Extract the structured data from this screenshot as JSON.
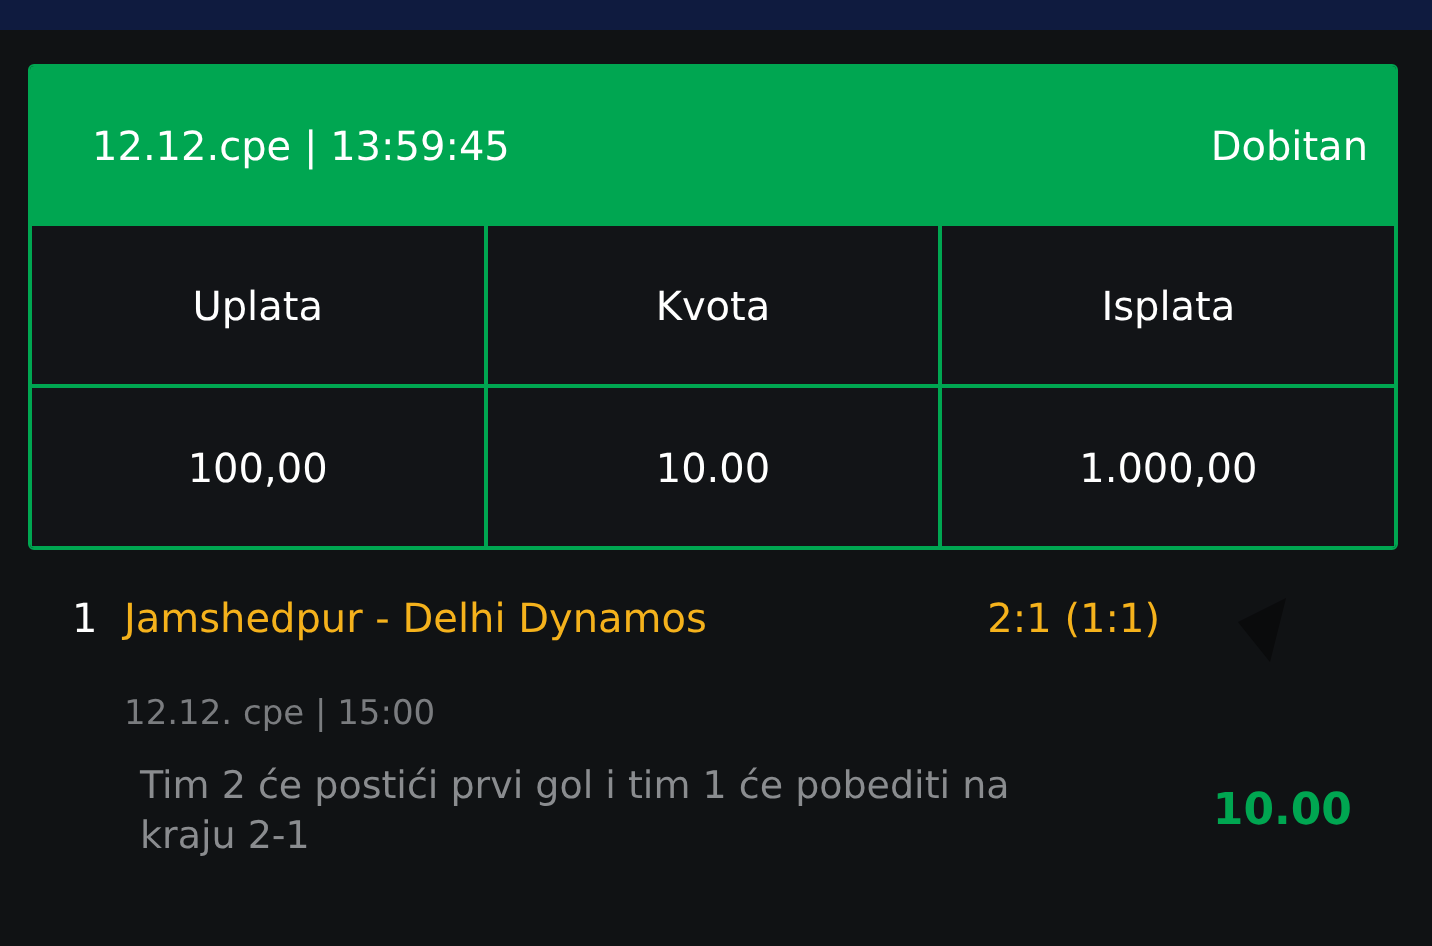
{
  "ticket": {
    "datetime": "12.12.cpe | 13:59:45",
    "status": "Dobitan",
    "columns": [
      "Uplata",
      "Kvota",
      "Isplata"
    ],
    "values": [
      "100,00",
      "10.00",
      "1.000,00"
    ]
  },
  "bets": [
    {
      "number": "1",
      "match": "Jamshedpur - Delhi Dynamos",
      "result": "2:1 (1:1)",
      "date": "12.12. cpe | 15:00",
      "pick": "Tim 2 će postići prvi gol i tim 1 će pobediti na kraju 2-1",
      "odds": "10.00"
    }
  ]
}
